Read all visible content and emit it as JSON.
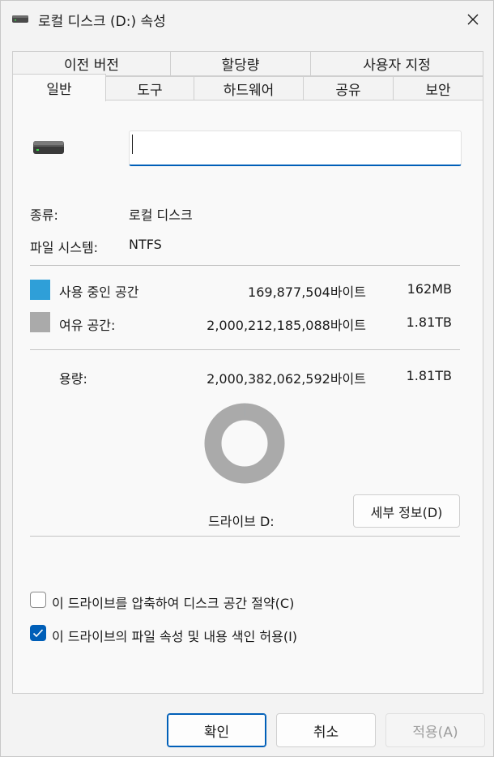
{
  "window": {
    "title": "로컬 디스크 (D:) 속성"
  },
  "tabs_back": [
    {
      "label": "이전 버전"
    },
    {
      "label": "할당량"
    },
    {
      "label": "사용자 지정"
    }
  ],
  "tabs_front": [
    {
      "label": "일반",
      "active": true
    },
    {
      "label": "도구"
    },
    {
      "label": "하드웨어"
    },
    {
      "label": "공유"
    },
    {
      "label": "보안"
    }
  ],
  "general": {
    "name_value": "",
    "type_label": "종류:",
    "type_value": "로컬 디스크",
    "fs_label": "파일 시스템:",
    "fs_value": "NTFS",
    "used_label": "사용 중인 공간",
    "used_bytes": "169,877,504바이트",
    "used_size": "162MB",
    "free_label": "여유 공간:",
    "free_bytes": "2,000,212,185,088바이트",
    "free_size": "1.81TB",
    "capacity_label": "용량:",
    "capacity_bytes": "2,000,382,062,592바이트",
    "capacity_size": "1.81TB",
    "drive_label": "드라이브 D:",
    "details_button": "세부 정보(D)",
    "used_fraction": 8.49e-05,
    "used_color": "#2f9fd8",
    "free_color": "#aaaaaa"
  },
  "options": {
    "compress_label": "이 드라이브를 압축하여 디스크 공간 절약(C)",
    "compress_checked": false,
    "index_label": "이 드라이브의 파일 속성 및 내용 색인 허용(I)",
    "index_checked": true
  },
  "footer": {
    "ok": "확인",
    "cancel": "취소",
    "apply": "적용(A)"
  },
  "icons": {
    "title": "drive-icon",
    "close": "close-icon",
    "drive": "drive-icon",
    "check": "checkmark-icon"
  },
  "accent_color": "#005fb8"
}
